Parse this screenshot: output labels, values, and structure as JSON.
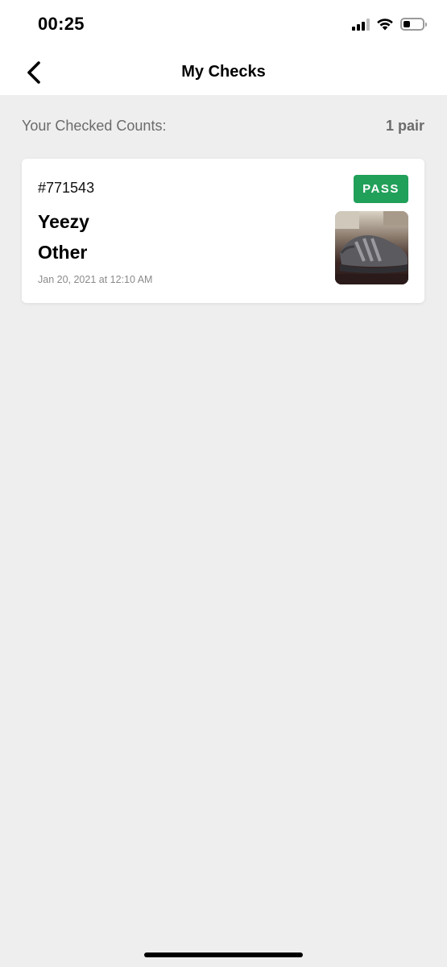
{
  "status_bar": {
    "time": "00:25",
    "icons": [
      "signal-icon",
      "wifi-icon",
      "battery-icon"
    ]
  },
  "nav": {
    "title": "My Checks",
    "back_icon": "chevron-left-icon"
  },
  "summary": {
    "label": "Your Checked Counts:",
    "count": "1 pair"
  },
  "checks": [
    {
      "id": "#771543",
      "status": "PASS",
      "status_color": "#21a05a",
      "brand": "Yeezy",
      "model": "Other",
      "date": "Jan 20, 2021 at 12:10 AM",
      "image": "sneaker-photo"
    }
  ],
  "colors": {
    "background": "#eeeeee",
    "card": "#ffffff",
    "pass_green": "#21a05a",
    "muted_text": "#6b6b6b"
  }
}
